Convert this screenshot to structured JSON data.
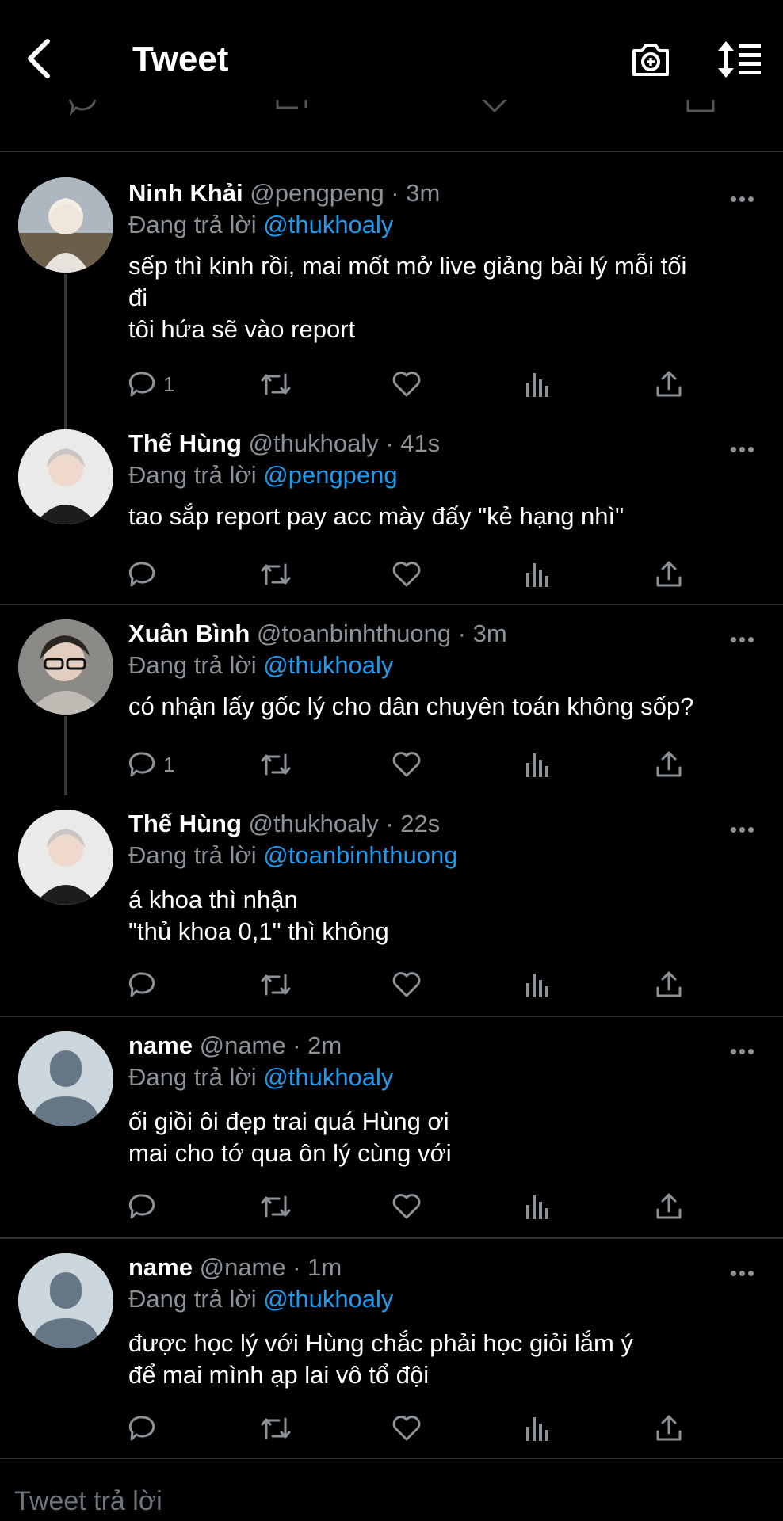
{
  "header": {
    "title": "Tweet",
    "back_icon": "chevron-left-icon",
    "camera_icon": "camera-add-icon",
    "sort_icon": "sort-icon"
  },
  "tweets": [
    {
      "name": "Ninh Khải",
      "handle": "@pengpeng · 3m",
      "replying_prefix": "Đang trả lời",
      "replying_to": "@thukhoaly",
      "text": "sếp thì kinh rồi, mai mốt mở live giảng bài lý mỗi tối\nđi\ntôi hứa sẽ vào report",
      "reply_count": "1",
      "avatar_color": "#c9c4bf"
    },
    {
      "name": "Thế Hùng",
      "handle": "@thukhoaly · 41s",
      "replying_prefix": "Đang trả lời",
      "replying_to": "@pengpeng",
      "text": "tao sắp report pay acc mày đấy \"kẻ hạng nhì\"",
      "reply_count": "",
      "avatar_color": "#d9d4d1"
    },
    {
      "name": "Xuân Bình",
      "handle": "@toanbinhthuong · 3m",
      "replying_prefix": "Đang trả lời",
      "replying_to": "@thukhoaly",
      "text": "có nhận lấy gốc lý cho dân chuyên toán không sốp?",
      "reply_count": "1",
      "avatar_color": "#7e7a76"
    },
    {
      "name": "Thế Hùng",
      "handle": "@thukhoaly · 22s",
      "replying_prefix": "Đang trả lời",
      "replying_to": "@toanbinhthuong",
      "text": "á khoa thì nhận\n\"thủ khoa 0,1\" thì không",
      "reply_count": "",
      "avatar_color": "#d9d4d1"
    },
    {
      "name": "name",
      "handle": "@name · 2m",
      "replying_prefix": "Đang trả lời",
      "replying_to": "@thukhoaly",
      "text": "ối giồi ôi đẹp trai quá Hùng ơi\nmai cho tớ qua ôn lý cùng với",
      "reply_count": "",
      "avatar_color": "#ccd6dd"
    },
    {
      "name": "name",
      "handle": "@name · 1m",
      "replying_prefix": "Đang trả lời",
      "replying_to": "@thukhoaly",
      "text": "được học lý với Hùng chắc phải học giỏi lắm ý\nđể mai mình ạp lai vô tổ đội",
      "reply_count": "",
      "avatar_color": "#ccd6dd"
    }
  ],
  "compose": {
    "placeholder": "Tweet trả lời"
  },
  "colors": {
    "background": "#000000",
    "accent": "#1d9bf0",
    "secondary_text": "#8b9298",
    "separator": "#2f3336"
  }
}
